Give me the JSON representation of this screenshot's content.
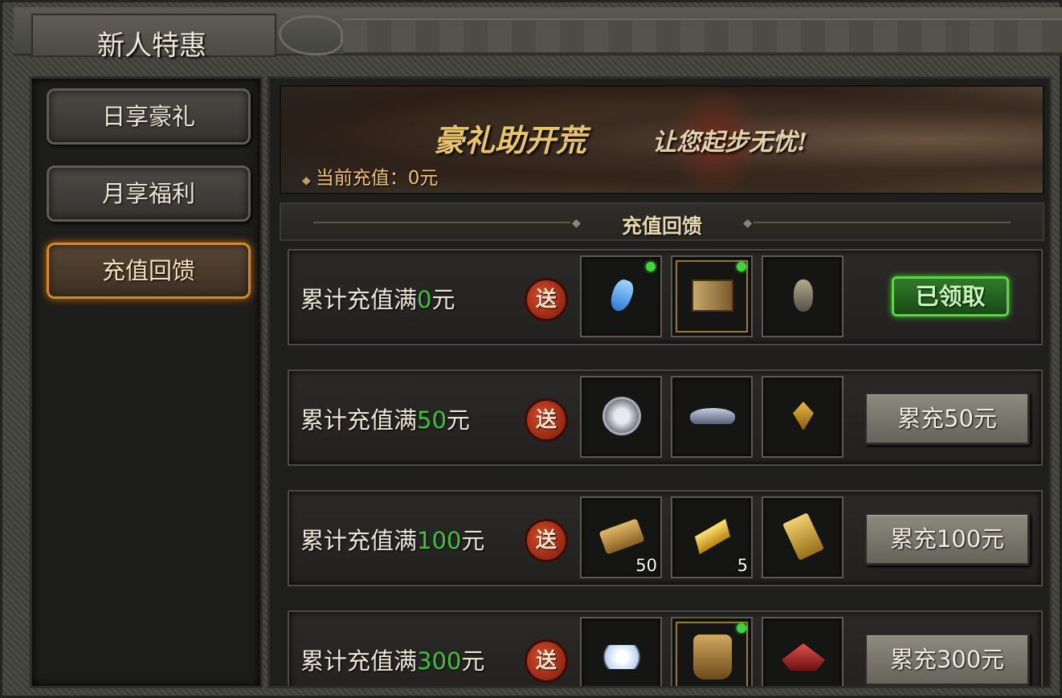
{
  "window": {
    "title": "新人特惠"
  },
  "sidebar": {
    "items": [
      {
        "label": "日享豪礼",
        "active": false
      },
      {
        "label": "月享福利",
        "active": false
      },
      {
        "label": "充值回馈",
        "active": true
      }
    ]
  },
  "banner": {
    "slogan_main": "豪礼助开荒",
    "slogan_sub": "让您起步无忧!",
    "recharge_label": "当前充值：0元"
  },
  "section": {
    "title": "充值回馈"
  },
  "rewards": [
    {
      "label_prefix": "累计充值满",
      "amount": "0",
      "label_suffix": "元",
      "badge": "送",
      "items": [
        {
          "icon": "blue-potion-icon",
          "count": ""
        },
        {
          "icon": "skill-book-icon",
          "count": ""
        },
        {
          "icon": "vase-icon",
          "count": ""
        }
      ],
      "button": "已领取",
      "claimed": true
    },
    {
      "label_prefix": "累计充值满",
      "amount": "50",
      "label_suffix": "元",
      "badge": "送",
      "items": [
        {
          "icon": "ring-icon",
          "count": ""
        },
        {
          "icon": "bamboo-hat-icon",
          "count": ""
        },
        {
          "icon": "amulet-icon",
          "count": ""
        }
      ],
      "button": "累充50元",
      "claimed": false
    },
    {
      "label_prefix": "累计充值满",
      "amount": "100",
      "label_suffix": "元",
      "badge": "送",
      "items": [
        {
          "icon": "scroll-icon",
          "count": "50"
        },
        {
          "icon": "gold-bar-icon",
          "count": "5"
        },
        {
          "icon": "talisman-icon",
          "count": ""
        }
      ],
      "button": "累充100元",
      "claimed": false
    },
    {
      "label_prefix": "累计充值满",
      "amount": "300",
      "label_suffix": "元",
      "badge": "送",
      "items": [
        {
          "icon": "crystal-pile-icon",
          "count": ""
        },
        {
          "icon": "armor-icon",
          "count": ""
        },
        {
          "icon": "crest-icon",
          "count": ""
        }
      ],
      "button": "累充300元",
      "claimed": false
    }
  ],
  "colors": {
    "amount_green": "#3ec43a",
    "active_orange": "#d08a2a",
    "claimed_green": "#5fd24a"
  }
}
